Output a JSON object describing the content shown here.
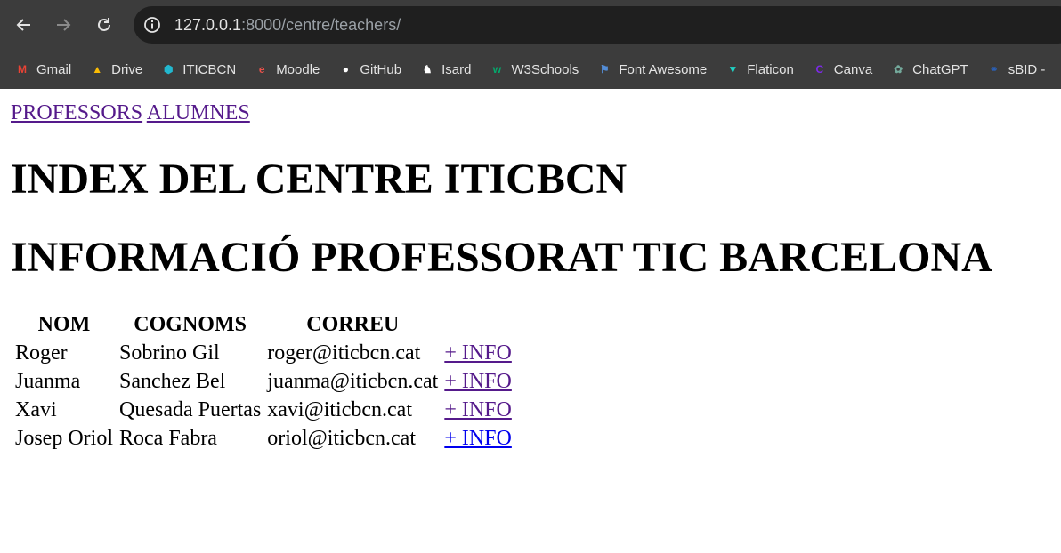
{
  "browser": {
    "url_host": "127.0.0.1",
    "url_rest": ":8000/centre/teachers/",
    "bookmarks": [
      {
        "label": "Gmail",
        "icon": "gmail-icon",
        "color": "#ea4335"
      },
      {
        "label": "Drive",
        "icon": "drive-icon",
        "color": "#fbbc04"
      },
      {
        "label": "ITICBCN",
        "icon": "iticbcn-icon",
        "color": "#22b8cf"
      },
      {
        "label": "Moodle",
        "icon": "moodle-icon",
        "color": "#e8514a"
      },
      {
        "label": "GitHub",
        "icon": "github-icon",
        "color": "#ffffff"
      },
      {
        "label": "Isard",
        "icon": "isard-icon",
        "color": "#ffffff"
      },
      {
        "label": "W3Schools",
        "icon": "w3schools-icon",
        "color": "#04aa6d"
      },
      {
        "label": "Font Awesome",
        "icon": "font-awesome-icon",
        "color": "#538dd7"
      },
      {
        "label": "Flaticon",
        "icon": "flaticon-icon",
        "color": "#1fd3c6"
      },
      {
        "label": "Canva",
        "icon": "canva-icon",
        "color": "#7d2ae8"
      },
      {
        "label": "ChatGPT",
        "icon": "chatgpt-icon",
        "color": "#74aa9c"
      },
      {
        "label": "sBID -",
        "icon": "sbid-icon",
        "color": "#2b5fb3"
      }
    ]
  },
  "nav": {
    "professors": "PROFESSORS",
    "alumnes": "ALUMNES"
  },
  "heading1": "INDEX DEL CENTRE ITICBCN",
  "heading2": "INFORMACIÓ PROFESSORAT TIC BARCELONA",
  "table": {
    "headers": [
      "NOM",
      "COGNOMS",
      "CORREU"
    ],
    "link_label": "+ INFO",
    "rows": [
      {
        "nom": "Roger",
        "cognoms": "Sobrino Gil",
        "correu": "roger@iticbcn.cat"
      },
      {
        "nom": "Juanma",
        "cognoms": "Sanchez Bel",
        "correu": "juanma@iticbcn.cat"
      },
      {
        "nom": "Xavi",
        "cognoms": "Quesada Puertas",
        "correu": "xavi@iticbcn.cat"
      },
      {
        "nom": "Josep Oriol",
        "cognoms": "Roca Fabra",
        "correu": "oriol@iticbcn.cat"
      }
    ]
  }
}
